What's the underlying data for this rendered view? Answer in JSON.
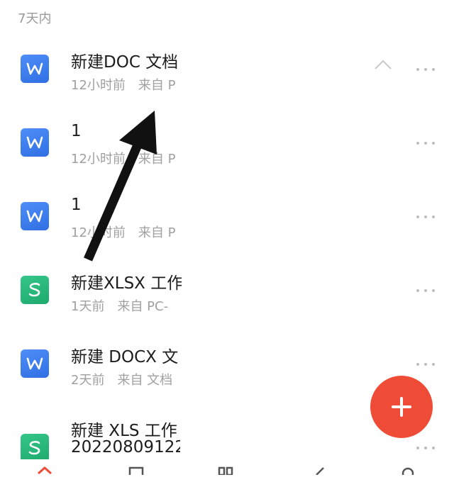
{
  "section": {
    "header": "7天内"
  },
  "files": [
    {
      "type": "word",
      "icon": "word-doc-icon",
      "title": "新建DOC 文档",
      "time": "12小时前",
      "source": "来自 P"
    },
    {
      "type": "word",
      "icon": "word-doc-icon",
      "title": "1",
      "time": "12小时前",
      "source": "来自 P"
    },
    {
      "type": "word",
      "icon": "word-doc-icon",
      "title": "1",
      "time": "12小时前",
      "source": "来自 P"
    },
    {
      "type": "sheet",
      "icon": "spreadsheet-icon",
      "title": "新建XLSX 工作",
      "time": "1天前",
      "source": "来自 PC-"
    },
    {
      "type": "word",
      "icon": "word-doc-icon",
      "title": "新建 DOCX 文",
      "time": "2天前",
      "source": "来自 文档"
    },
    {
      "type": "sheet",
      "icon": "spreadsheet-icon",
      "title": "新建 XLS 工作",
      "title_line2": "20220809122",
      "time": "",
      "source": ""
    }
  ],
  "colors": {
    "word_icon": "#3b7cf0",
    "sheet_icon": "#27b57a",
    "fab": "#ee4c37",
    "annotation_arrow": "#111111",
    "bottom_tab_active": "#ee4c37"
  },
  "fab": {
    "icon": "plus-icon"
  },
  "annotation": {
    "icon": "pointer-arrow-icon"
  }
}
